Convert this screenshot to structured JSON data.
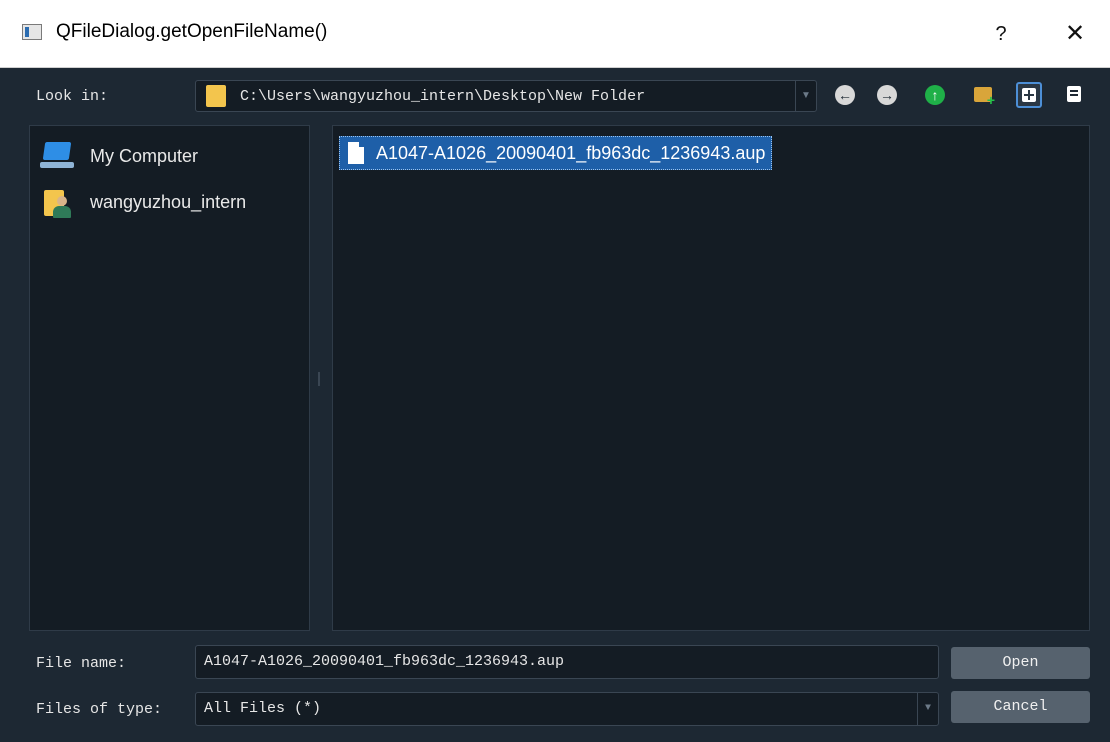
{
  "window": {
    "title": "QFileDialog.getOpenFileName()",
    "help_label": "?",
    "close_label": "✕"
  },
  "toolbar": {
    "look_in_label": "Look in:",
    "path": "C:\\Users\\wangyuzhou_intern\\Desktop\\New Folder",
    "dropdown_glyph": "▼",
    "back_glyph": "←",
    "forward_glyph": "→",
    "up_glyph": "↑",
    "icons": [
      "back-icon",
      "forward-icon",
      "parent-folder-icon",
      "new-folder-icon",
      "icon-view-icon",
      "detail-view-icon"
    ]
  },
  "sidebar": {
    "items": [
      {
        "label": "My Computer",
        "icon": "computer-icon"
      },
      {
        "label": "wangyuzhou_intern",
        "icon": "user-folder-icon"
      }
    ]
  },
  "files": {
    "items": [
      {
        "label": "A1047-A1026_20090401_fb963dc_1236943.aup",
        "icon": "file-icon",
        "selected": true
      }
    ]
  },
  "form": {
    "file_name_label": "File name:",
    "file_name_value": "A1047-A1026_20090401_fb963dc_1236943.aup",
    "file_type_label": "Files of type:",
    "file_type_value": "All Files (*)",
    "dropdown_glyph": "▼"
  },
  "buttons": {
    "open": "Open",
    "cancel": "Cancel"
  },
  "colors": {
    "background": "#1d2833",
    "panel": "#141c24",
    "selection": "#1e5fa8",
    "button": "#56626e",
    "accent": "#4d8fd6"
  }
}
